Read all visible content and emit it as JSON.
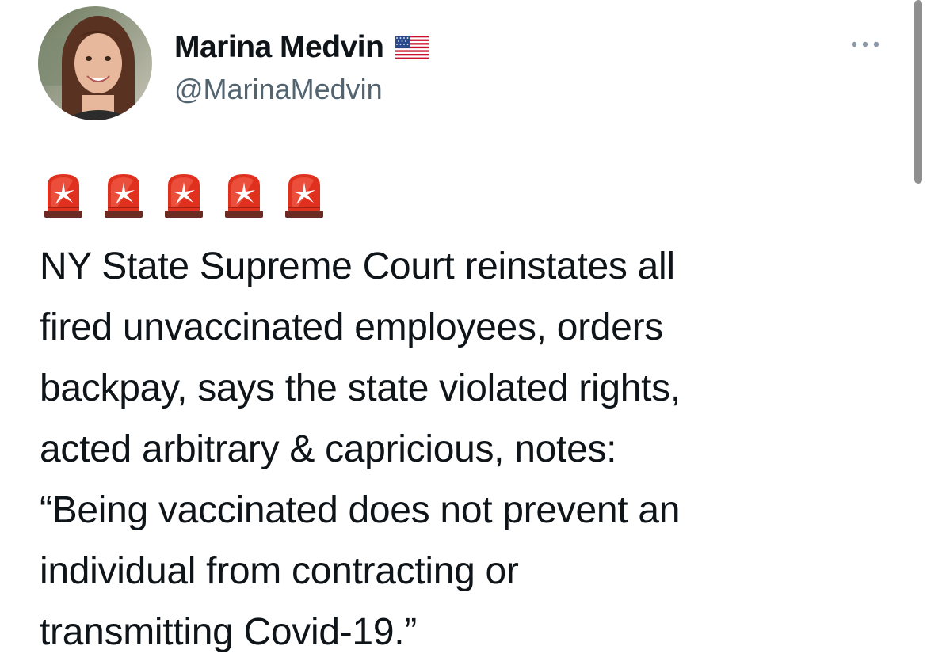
{
  "author": {
    "display_name": "Marina Medvin",
    "handle": "@MarinaMedvin",
    "badge_icon": "us-flag-icon",
    "avatar_icon": "profile-photo"
  },
  "actions": {
    "more_icon": "more-options-icon"
  },
  "emoji_row": {
    "icon": "police-car-light-icon",
    "count": 5
  },
  "tweet": {
    "lines": [
      "NY State Supreme Court reinstates all",
      "fired unvaccinated employees, orders",
      "backpay, says the state violated rights,",
      "acted arbitrary & capricious, notes:",
      "“Being vaccinated does not prevent an",
      "individual from contracting or",
      "transmitting Covid-19.”"
    ]
  },
  "colors": {
    "text_primary": "#0f1419",
    "text_secondary": "#536471",
    "siren_red": "#e0301e",
    "background": "#ffffff"
  }
}
